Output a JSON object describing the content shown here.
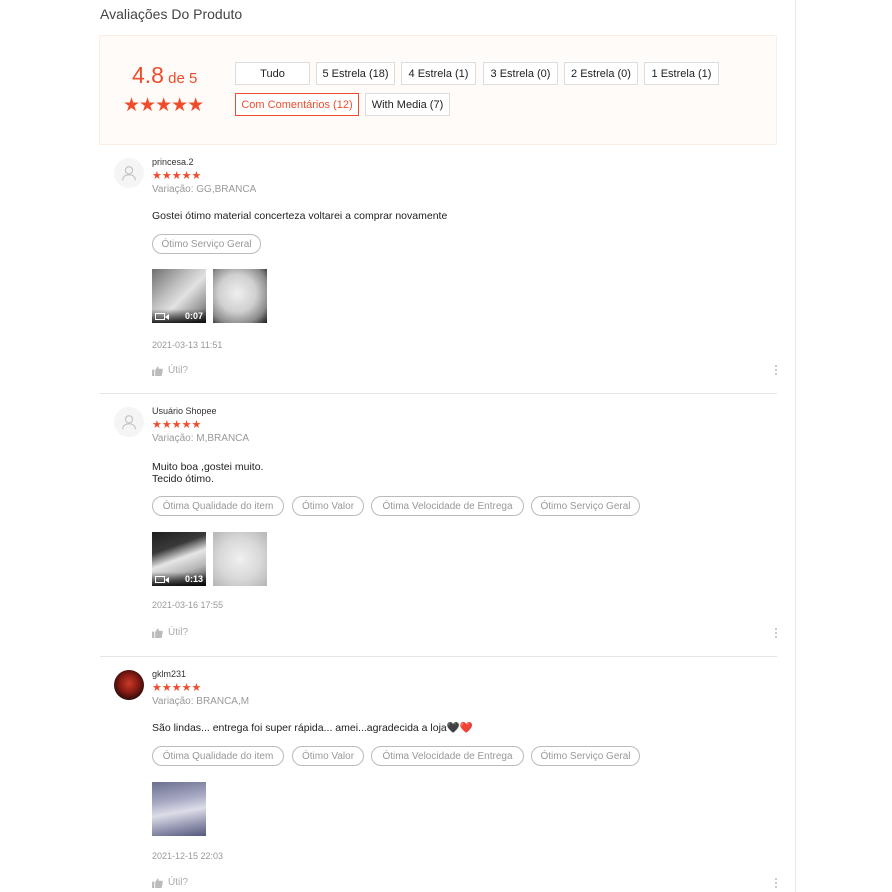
{
  "section_title": "Avaliações Do Produto",
  "overview": {
    "score": "4.8",
    "out_of": " de 5",
    "stars": "★★★★★",
    "filters": [
      "Tudo",
      "5 Estrela (18)",
      "4 Estrela (1)",
      "3 Estrela (0)",
      "2 Estrela (0)",
      "1 Estrela (1)",
      "Com Comentários (12)",
      "With Media (7)"
    ],
    "active_filter": "Com Comentários (12)"
  },
  "reviews": [
    {
      "username": "princesa.2",
      "stars": "★★★★★",
      "variation": "Variação: GG,BRANCA",
      "comment": "Gostei ótimo material concerteza voltarei a comprar novamente",
      "tags": [
        "Ótimo Serviço Geral"
      ],
      "video_duration": "0:07",
      "date": "2021-03-13 11:51",
      "useful": "Útil?"
    },
    {
      "username": "Usuário Shopee",
      "stars": "★★★★★",
      "variation": "Variação: M,BRANCA",
      "comment": "Muito boa ,gostei muito.\nTecido ótimo.",
      "tags": [
        "Ótima Qualidade do item",
        "Ótimo Valor",
        "Ótima Velocidade de Entrega",
        "Ótimo Serviço Geral"
      ],
      "video_duration": "0:13",
      "date": "2021-03-16 17:55",
      "useful": "Útil?"
    },
    {
      "username": "gklm231",
      "stars": "★★★★★",
      "variation": "Variação: BRANCA,M",
      "comment": "São lindas...  entrega foi super rápida... amei...agradecida a loja🖤❤️",
      "tags": [
        "Ótima Qualidade do item",
        "Ótimo Valor",
        "Ótima Velocidade de Entrega",
        "Ótimo Serviço Geral"
      ],
      "date": "2021-12-15 22:03",
      "useful": "Útil?"
    }
  ],
  "colors": {
    "accent": "#ee4d2d",
    "panel_bg": "#fffbf8"
  }
}
